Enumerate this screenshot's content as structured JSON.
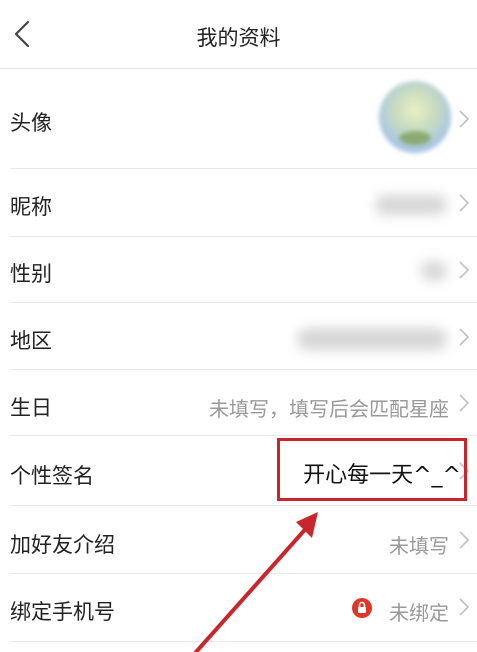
{
  "header": {
    "title": "我的资料",
    "back_icon": "chevron-left-icon"
  },
  "rows": [
    {
      "label": "头像"
    },
    {
      "label": "昵称"
    },
    {
      "label": "性别"
    },
    {
      "label": "地区"
    },
    {
      "label": "生日",
      "value": "未填写，填写后会匹配星座"
    },
    {
      "label": "个性签名",
      "value": "开心每一天^_^"
    },
    {
      "label": "加好友介绍",
      "value": "未填写"
    },
    {
      "label": "绑定手机号",
      "value": "未绑定",
      "status_icon": "lock-icon"
    }
  ],
  "colors": {
    "highlight": "#c9262c",
    "lock_badge": "#e0352b",
    "muted_text": "#999999"
  }
}
